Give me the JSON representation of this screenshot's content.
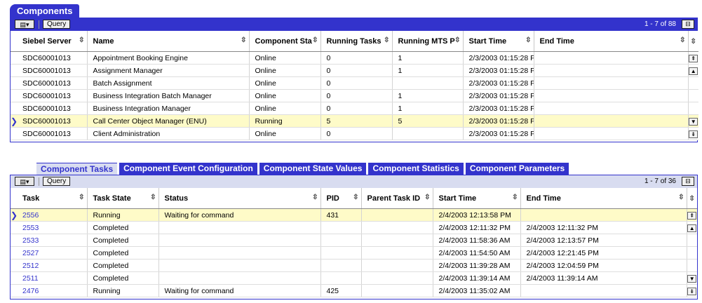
{
  "components": {
    "title": "Components",
    "toolbar": {
      "menu_icon": "menu-icon",
      "query_label": "Query",
      "count": "1 - 7 of 88"
    },
    "columns": [
      "Siebel Server",
      "Name",
      "Component Sta",
      "Running Tasks",
      "Running MTS P",
      "Start Time",
      "End Time"
    ],
    "rows": [
      [
        "SDC60001013",
        "Appointment Booking Engine",
        "Online",
        "0",
        "1",
        "2/3/2003 01:15:28 P",
        ""
      ],
      [
        "SDC60001013",
        "Assignment Manager",
        "Online",
        "0",
        "1",
        "2/3/2003 01:15:28 P",
        ""
      ],
      [
        "SDC60001013",
        "Batch Assignment",
        "Online",
        "0",
        "",
        "2/3/2003 01:15:28 P",
        ""
      ],
      [
        "SDC60001013",
        "Business Integration Batch Manager",
        "Online",
        "0",
        "1",
        "2/3/2003 01:15:28 P",
        ""
      ],
      [
        "SDC60001013",
        "Business Integration Manager",
        "Online",
        "0",
        "1",
        "2/3/2003 01:15:28 P",
        ""
      ],
      [
        "SDC60001013",
        "Call Center Object Manager (ENU)",
        "Running",
        "5",
        "5",
        "2/3/2003 01:15:28 P",
        ""
      ],
      [
        "SDC60001013",
        "Client Administration",
        "Online",
        "0",
        "",
        "2/3/2003 01:15:28 P",
        ""
      ]
    ],
    "selected_row": 5
  },
  "tasks": {
    "tabs": [
      "Component Tasks",
      "Component Event Configuration",
      "Component State Values",
      "Component Statistics",
      "Component Parameters"
    ],
    "active_tab": 0,
    "toolbar": {
      "query_label": "Query",
      "count": "1 - 7 of 36"
    },
    "columns": [
      "Task",
      "Task State",
      "Status",
      "PID",
      "Parent Task ID",
      "Start Time",
      "End Time"
    ],
    "rows": [
      [
        "2556",
        "Running",
        "Waiting for command",
        "431",
        "",
        "2/4/2003 12:13:58 PM",
        ""
      ],
      [
        "2553",
        "Completed",
        "",
        "",
        "",
        "2/4/2003 12:11:32 PM",
        "2/4/2003 12:11:32 PM"
      ],
      [
        "2533",
        "Completed",
        "",
        "",
        "",
        "2/4/2003 11:58:36 AM",
        "2/4/2003 12:13:57 PM"
      ],
      [
        "2527",
        "Completed",
        "",
        "",
        "",
        "2/4/2003 11:54:50 AM",
        "2/4/2003 12:21:45 PM"
      ],
      [
        "2512",
        "Completed",
        "",
        "",
        "",
        "2/4/2003 11:39:28 AM",
        "2/4/2003 12:04:59 PM"
      ],
      [
        "2511",
        "Completed",
        "",
        "",
        "",
        "2/4/2003 11:39:14 AM",
        "2/4/2003 11:39:14 AM"
      ],
      [
        "2476",
        "Running",
        "Waiting for command",
        "425",
        "",
        "2/4/2003 11:35:02 AM",
        ""
      ]
    ],
    "selected_row": 0
  },
  "colors": {
    "accent": "#3333cc",
    "selected_row": "#fefbc8",
    "toolbar_light": "#d8dcf0"
  }
}
